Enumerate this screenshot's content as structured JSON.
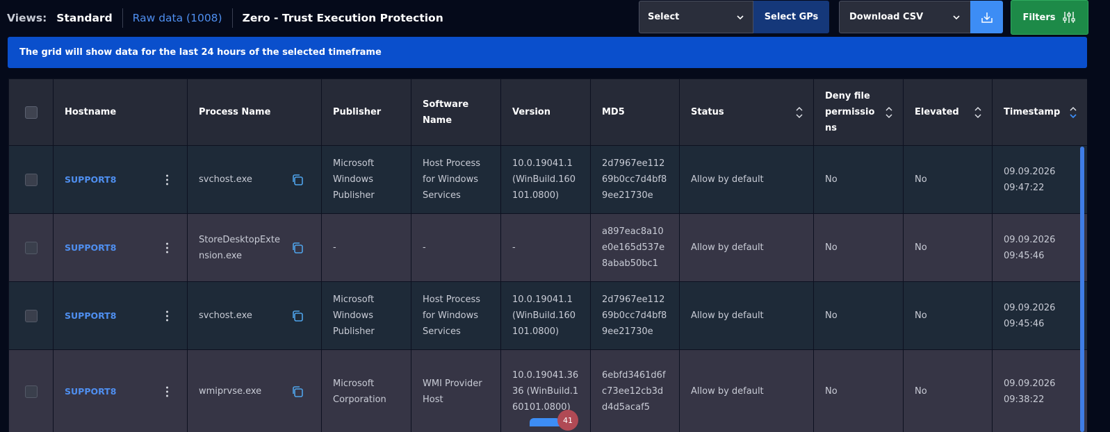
{
  "views": {
    "label": "Views:",
    "items": [
      "Standard",
      "Raw data (1008)",
      "Zero - Trust Execution Protection"
    ]
  },
  "toolbar": {
    "select_label": "Select",
    "select_gps_label": "Select GPs",
    "download_csv_label": "Download CSV",
    "filters_label": "Filters"
  },
  "banner": {
    "text": "The grid will show data for the last 24 hours of the selected timeframe"
  },
  "grid": {
    "columns": [
      "Hostname",
      "Process Name",
      "Publisher",
      "Software Name",
      "Version",
      "MD5",
      "Status",
      "Deny file permissions",
      "Elevated",
      "Timestamp"
    ],
    "rows": [
      {
        "hostname": "SUPPORT8",
        "process": "svchost.exe",
        "publisher": "Microsoft Windows Publisher",
        "software": "Host Process for Windows Services",
        "version": "10.0.19041.1 (WinBuild.160101.0800)",
        "md5": "2d7967ee11269b0cc7d4bf89ee21730e",
        "status": "Allow by default",
        "deny": "No",
        "elevated": "No",
        "date": "09.09.2026",
        "time": "09:47:22"
      },
      {
        "hostname": "SUPPORT8",
        "process": "StoreDesktopExtension.exe",
        "publisher": "-",
        "software": "-",
        "version": "-",
        "md5": "a897eac8a10e0e165d537e8abab50bc1",
        "status": "Allow by default",
        "deny": "No",
        "elevated": "No",
        "date": "09.09.2026",
        "time": "09:45:46"
      },
      {
        "hostname": "SUPPORT8",
        "process": "svchost.exe",
        "publisher": "Microsoft Windows Publisher",
        "software": "Host Process for Windows Services",
        "version": "10.0.19041.1 (WinBuild.160101.0800)",
        "md5": "2d7967ee11269b0cc7d4bf89ee21730e",
        "status": "Allow by default",
        "deny": "No",
        "elevated": "No",
        "date": "09.09.2026",
        "time": "09:45:46"
      },
      {
        "hostname": "SUPPORT8",
        "process": "wmiprvse.exe",
        "publisher": "Microsoft Corporation",
        "software": "WMI Provider Host",
        "version": "10.0.19041.3636 (WinBuild.160101.0800)",
        "md5": "6ebfd3461d6fc73ee12cb3dd4d5acaf5",
        "status": "Allow by default",
        "deny": "No",
        "elevated": "No",
        "date": "09.09.2026",
        "time": "09:38:22"
      }
    ]
  },
  "badge": {
    "count": "41"
  },
  "colors": {
    "accent": "#3d8df5",
    "banner": "#0a4fcc",
    "filters": "#1d8a48",
    "link": "#4f8ff0"
  }
}
